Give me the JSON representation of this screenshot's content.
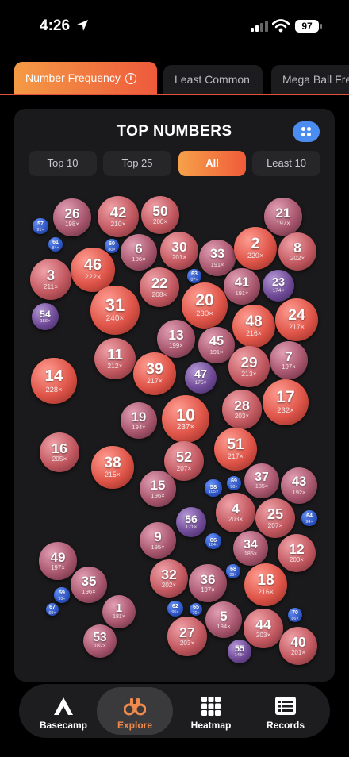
{
  "status": {
    "time": "4:26",
    "battery": "97"
  },
  "tabs": [
    {
      "label": "Number Frequency",
      "active": true
    },
    {
      "label": "Least Common",
      "active": false
    },
    {
      "label": "Mega Ball Fre",
      "active": false
    }
  ],
  "panel": {
    "title": "TOP NUMBERS",
    "filters": [
      {
        "label": "Top 10",
        "active": false
      },
      {
        "label": "Top 25",
        "active": false
      },
      {
        "label": "All",
        "active": true
      },
      {
        "label": "Least 10",
        "active": false
      }
    ]
  },
  "bubbles": [
    {
      "n": "26",
      "c": "198×"
    },
    {
      "n": "42",
      "c": "210×"
    },
    {
      "n": "50",
      "c": "200×"
    },
    {
      "n": "21",
      "c": "197×"
    },
    {
      "n": "57",
      "c": "91×"
    },
    {
      "n": "61",
      "c": "84×"
    },
    {
      "n": "60",
      "c": "80×"
    },
    {
      "n": "6",
      "c": "196×"
    },
    {
      "n": "30",
      "c": "201×"
    },
    {
      "n": "33",
      "c": "191×"
    },
    {
      "n": "2",
      "c": "220×"
    },
    {
      "n": "8",
      "c": "202×"
    },
    {
      "n": "46",
      "c": "222×"
    },
    {
      "n": "3",
      "c": "211×"
    },
    {
      "n": "63",
      "c": "87×"
    },
    {
      "n": "22",
      "c": "208×"
    },
    {
      "n": "41",
      "c": "191×"
    },
    {
      "n": "23",
      "c": "174×"
    },
    {
      "n": "31",
      "c": "240×"
    },
    {
      "n": "20",
      "c": "230×"
    },
    {
      "n": "54",
      "c": "156×"
    },
    {
      "n": "48",
      "c": "216×"
    },
    {
      "n": "24",
      "c": "217×"
    },
    {
      "n": "13",
      "c": "199×"
    },
    {
      "n": "45",
      "c": "191×"
    },
    {
      "n": "11",
      "c": "212×"
    },
    {
      "n": "7",
      "c": "197×"
    },
    {
      "n": "29",
      "c": "213×"
    },
    {
      "n": "39",
      "c": "217×"
    },
    {
      "n": "47",
      "c": "175×"
    },
    {
      "n": "14",
      "c": "228×"
    },
    {
      "n": "17",
      "c": "232×"
    },
    {
      "n": "28",
      "c": "203×"
    },
    {
      "n": "19",
      "c": "194×"
    },
    {
      "n": "10",
      "c": "237×"
    },
    {
      "n": "51",
      "c": "217×"
    },
    {
      "n": "16",
      "c": "205×"
    },
    {
      "n": "52",
      "c": "207×"
    },
    {
      "n": "38",
      "c": "215×"
    },
    {
      "n": "37",
      "c": "185×"
    },
    {
      "n": "43",
      "c": "192×"
    },
    {
      "n": "58",
      "c": "105×"
    },
    {
      "n": "69",
      "c": "88×"
    },
    {
      "n": "15",
      "c": "196×"
    },
    {
      "n": "4",
      "c": "203×"
    },
    {
      "n": "25",
      "c": "207×"
    },
    {
      "n": "64",
      "c": "94×"
    },
    {
      "n": "56",
      "c": "171×"
    },
    {
      "n": "9",
      "c": "195×"
    },
    {
      "n": "66",
      "c": "104×"
    },
    {
      "n": "34",
      "c": "185×"
    },
    {
      "n": "12",
      "c": "200×"
    },
    {
      "n": "49",
      "c": "197×"
    },
    {
      "n": "68",
      "c": "89×"
    },
    {
      "n": "32",
      "c": "202×"
    },
    {
      "n": "36",
      "c": "197×"
    },
    {
      "n": "35",
      "c": "196×"
    },
    {
      "n": "18",
      "c": "216×"
    },
    {
      "n": "59",
      "c": "93×"
    },
    {
      "n": "67",
      "c": "69×"
    },
    {
      "n": "1",
      "c": "181×"
    },
    {
      "n": "62",
      "c": "95×"
    },
    {
      "n": "65",
      "c": "76×"
    },
    {
      "n": "5",
      "c": "194×"
    },
    {
      "n": "70",
      "c": "86×"
    },
    {
      "n": "44",
      "c": "203×"
    },
    {
      "n": "27",
      "c": "203×"
    },
    {
      "n": "53",
      "c": "182×"
    },
    {
      "n": "40",
      "c": "201×"
    },
    {
      "n": "55",
      "c": "143×"
    }
  ],
  "nav": [
    {
      "label": "Basecamp",
      "active": false
    },
    {
      "label": "Explore",
      "active": true
    },
    {
      "label": "Heatmap",
      "active": false
    },
    {
      "label": "Records",
      "active": false
    }
  ],
  "colors": {
    "accent": "#ef5b3a",
    "accent_light": "#f6a149",
    "blue": "#4a8cf0",
    "panel": "#1a1a1c"
  }
}
